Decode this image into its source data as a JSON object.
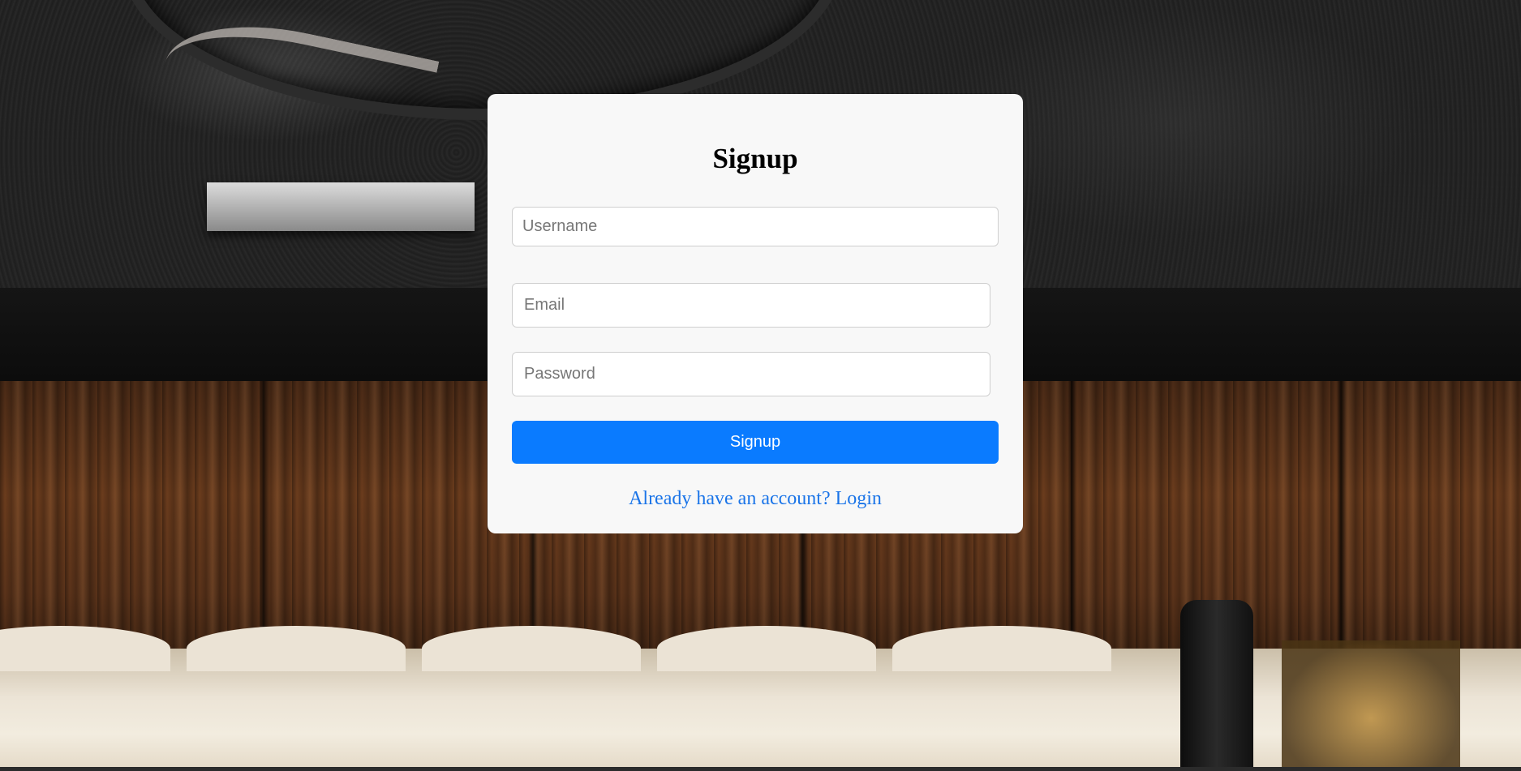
{
  "signup_form": {
    "title": "Signup",
    "username": {
      "placeholder": "Username",
      "value": ""
    },
    "email": {
      "placeholder": "Email",
      "value": ""
    },
    "password": {
      "placeholder": "Password",
      "value": ""
    },
    "submit_label": "Signup",
    "login_link_text": "Already have an account? Login"
  },
  "colors": {
    "card_background": "#f8f8f8",
    "button_background": "#0a7bff",
    "button_text": "#ffffff",
    "link": "#1a74e8"
  }
}
